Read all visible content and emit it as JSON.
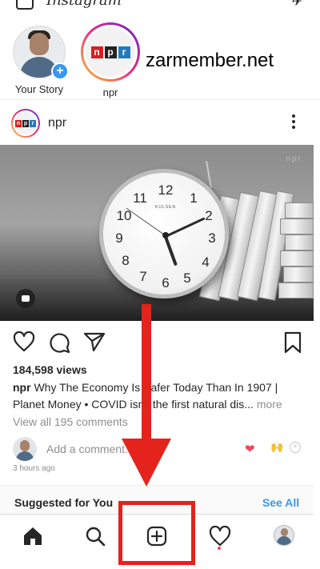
{
  "header": {
    "app_logo_text": "Instagram"
  },
  "stories": [
    {
      "label": "Your Story"
    },
    {
      "label": "npr"
    }
  ],
  "watermark": "zarmember.net",
  "npr_logo_letters": [
    "n",
    "p",
    "r"
  ],
  "post": {
    "username": "npr",
    "photo_watermark": "npr",
    "clock_brand": "KULSEN",
    "clock_numbers": [
      "12",
      "1",
      "2",
      "3",
      "4",
      "5",
      "6",
      "7",
      "8",
      "9",
      "10",
      "11"
    ],
    "views": "184,598 views",
    "caption_user": "npr",
    "caption_text": "Why The Economy Is Safer Today Than In 1907 | Planet Money • COVID isn't the first natural dis...",
    "caption_more": "more",
    "view_comments": "View all 195 comments",
    "comment_placeholder": "Add a comment...",
    "timestamp": "3 hours ago"
  },
  "suggested": {
    "title": "Suggested for You",
    "see_all": "See All"
  },
  "icons": {
    "like": "heart-icon",
    "comment": "comment-icon",
    "share": "send-icon",
    "save": "bookmark-icon",
    "home": "home-icon",
    "search": "search-icon",
    "new_post": "plus-square-icon",
    "activity": "heart-icon",
    "profile": "avatar"
  },
  "colors": {
    "accent_blue": "#3897f0",
    "annotation_red": "#e3231c",
    "like_red": "#ed4956",
    "npr_red": "#d62021",
    "npr_black": "#222222",
    "npr_blue": "#237bbd"
  }
}
